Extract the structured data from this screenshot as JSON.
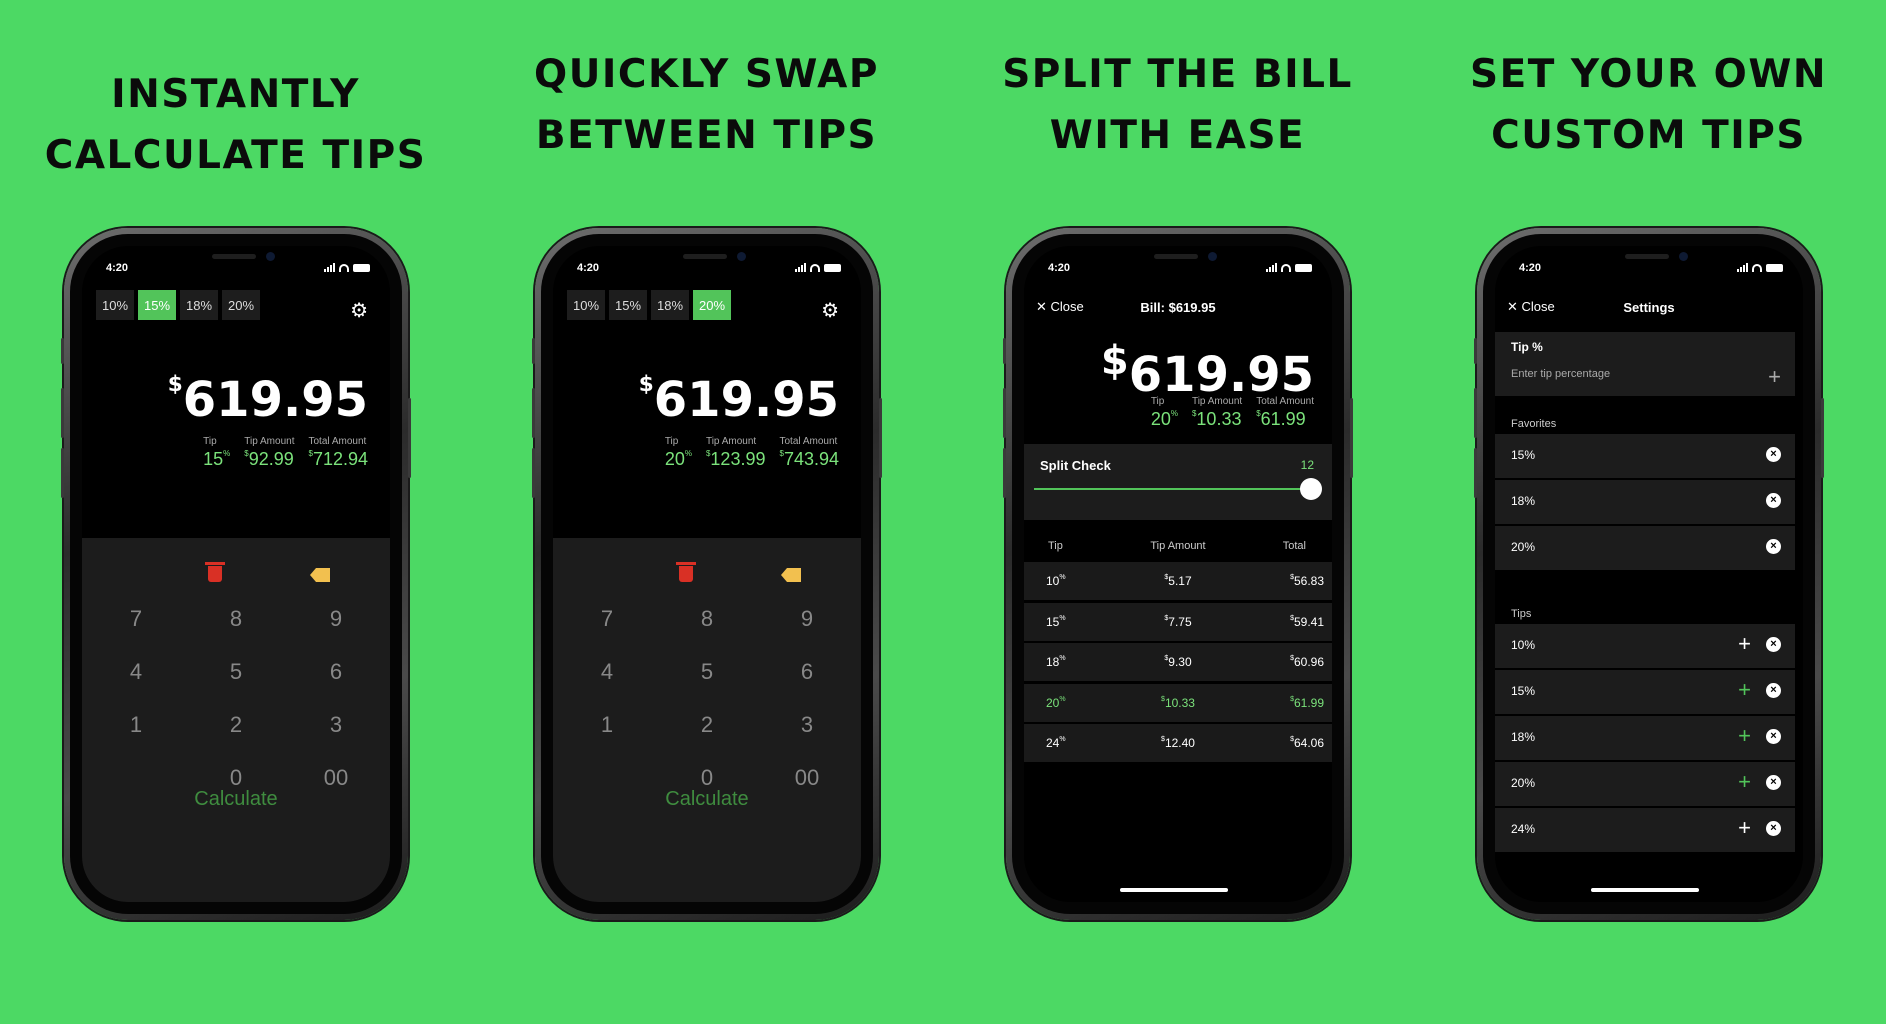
{
  "headlines": [
    [
      "INSTANTLY",
      "CALCULATE TIPS"
    ],
    [
      "QUICKLY SWAP",
      "BETWEEN TIPS"
    ],
    [
      "SPLIT THE BILL",
      "WITH EASE"
    ],
    [
      "SET YOUR OWN",
      "CUSTOM TIPS"
    ]
  ],
  "status_time": "4:20",
  "colors": {
    "background": "#4cd964",
    "accent": "#52c45a",
    "green_text": "#7be27b",
    "delete": "#d93025",
    "tag": "#f2c04f"
  },
  "calc1": {
    "tips": [
      "10%",
      "15%",
      "18%",
      "20%"
    ],
    "active_tip_index": 1,
    "bill": "619.95",
    "currency": "$",
    "tip_label": "Tip",
    "tip_amount_label": "Tip Amount",
    "total_label": "Total Amount",
    "tip_value": "15",
    "tip_unit": "%",
    "tip_amount": "92.99",
    "total": "712.94",
    "keys": [
      "7",
      "8",
      "9",
      "4",
      "5",
      "6",
      "1",
      "2",
      "3",
      "0",
      "00"
    ],
    "calculate": "Calculate"
  },
  "calc2": {
    "tips": [
      "10%",
      "15%",
      "18%",
      "20%"
    ],
    "active_tip_index": 3,
    "bill": "619.95",
    "currency": "$",
    "tip_label": "Tip",
    "tip_amount_label": "Tip Amount",
    "total_label": "Total Amount",
    "tip_value": "20",
    "tip_unit": "%",
    "tip_amount": "123.99",
    "total": "743.94",
    "keys": [
      "7",
      "8",
      "9",
      "4",
      "5",
      "6",
      "1",
      "2",
      "3",
      "0",
      "00"
    ],
    "calculate": "Calculate"
  },
  "split": {
    "close": "Close",
    "title": "Bill: $619.95",
    "currency": "$",
    "bill": "619.95",
    "tip_label": "Tip",
    "tip_amount_label": "Tip Amount",
    "total_label": "Total Amount",
    "tip_value": "20",
    "tip_unit": "%",
    "tip_amount": "10.33",
    "total": "61.99",
    "split_label": "Split Check",
    "split_count": "12",
    "table_headers": [
      "Tip",
      "Tip Amount",
      "Total"
    ],
    "rows": [
      {
        "tip": "10",
        "amount": "5.17",
        "total": "56.83",
        "highlight": false
      },
      {
        "tip": "15",
        "amount": "7.75",
        "total": "59.41",
        "highlight": false
      },
      {
        "tip": "18",
        "amount": "9.30",
        "total": "60.96",
        "highlight": false
      },
      {
        "tip": "20",
        "amount": "10.33",
        "total": "61.99",
        "highlight": true
      },
      {
        "tip": "24",
        "amount": "12.40",
        "total": "64.06",
        "highlight": false
      }
    ]
  },
  "settings": {
    "close": "Close",
    "title": "Settings",
    "tip_section": "Tip %",
    "tip_placeholder": "Enter tip percentage",
    "favorites_label": "Favorites",
    "favorites": [
      "15%",
      "18%",
      "20%"
    ],
    "tips_label": "Tips",
    "tips": [
      "10%",
      "15%",
      "18%",
      "20%",
      "24%"
    ]
  }
}
